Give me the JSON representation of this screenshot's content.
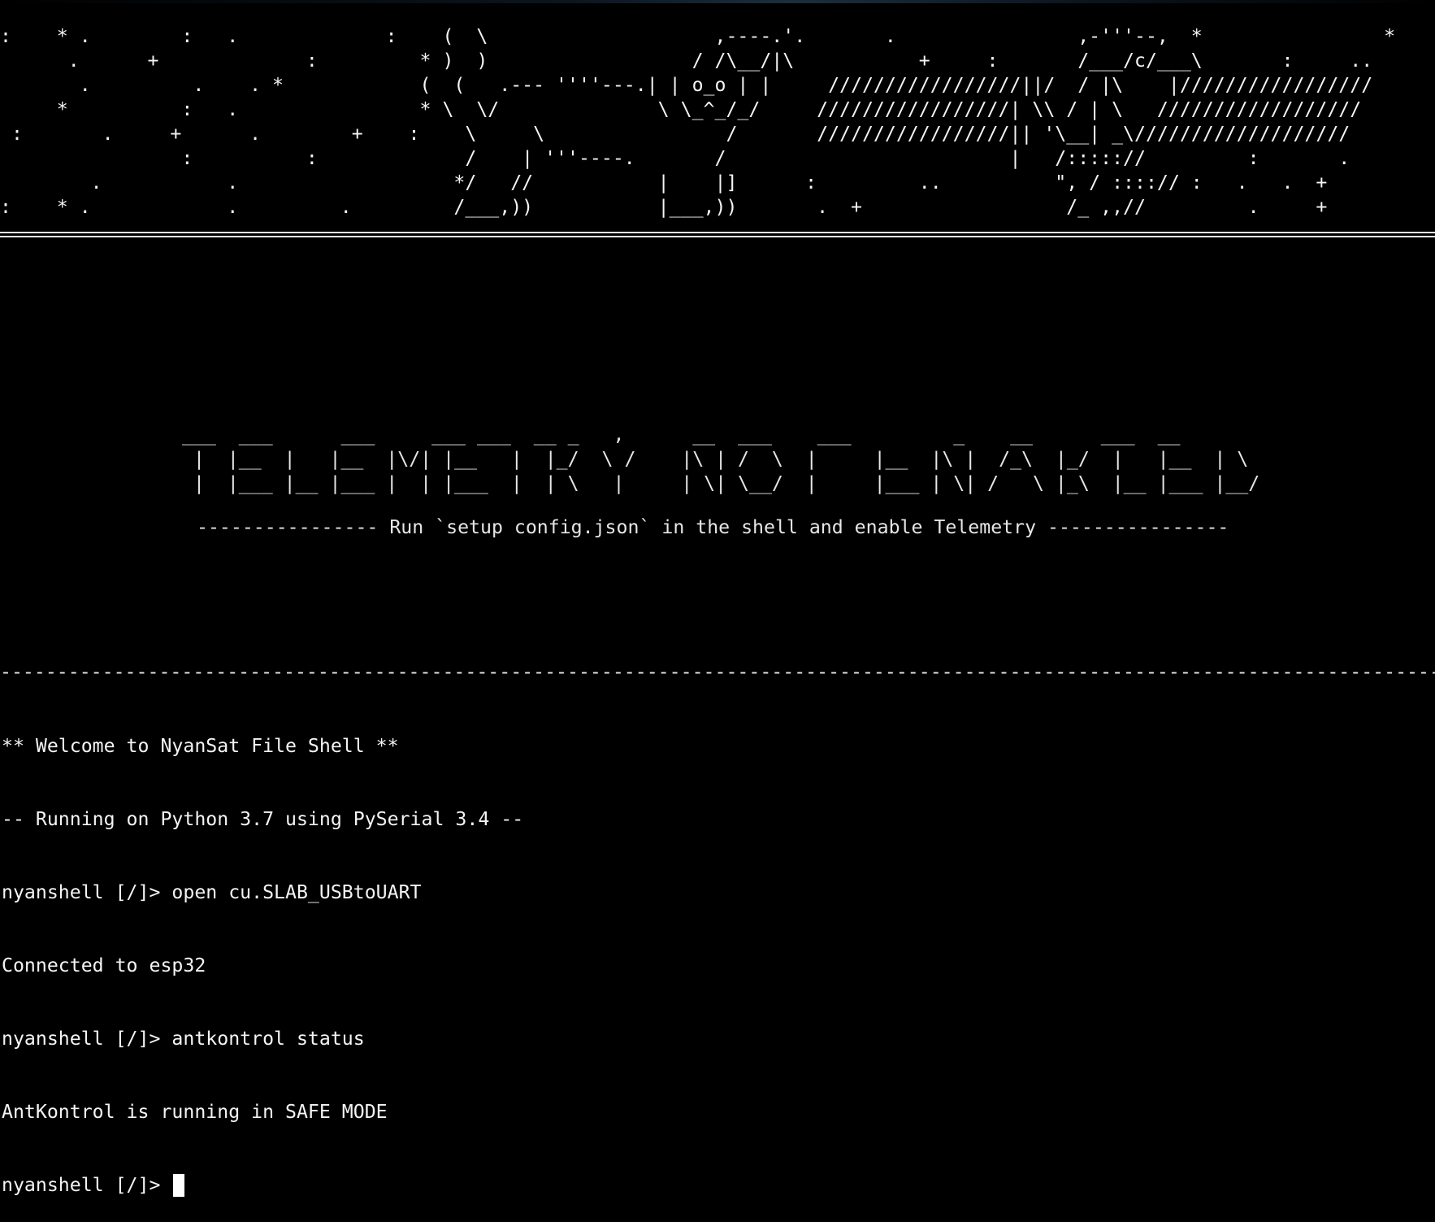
{
  "banner": {
    "art": ":    * .        :   .             :    (  \\                    ,----.'.       .                ,-'''--,  *                *\n      .      +             :         * )  )                  / /\\__/|\\           +     :       /___/c/___\\       :     ..\n       .         .    . *            (  (   .--- ''''---.| | o_o | |     /////////////////||/  / |\\    |/////////////////\n     *          :   .                * \\  \\/              \\ \\_^_/_/     /////////////////| \\\\ / | \\   //////////////////\n :       .     +      .        +    :    \\     \\                /       /////////////////|| '\\__| _\\///////////////////\n                :          :             /    | '''----.       /                         |   /::::://         :       .\n        .           .                   */   //           |    |]      :         ..          \", / ::::// :   .   .  +\n:    * .            .         .         /___,))           |___,))       .  +                  /_ ,,//         .     +"
  },
  "telemetry": {
    "title_art": "___  ___      ___     ___ ___  __ _   ,      __  ___    ___         _    __      ___  __\n |  |__  |   |__  |\\/| |__   |  |_/  \\ /    |\\ | /  \\  |     |__  |\\ |  /_\\  |_/  |   |__  | \\\n |  |___ |__ |___ |  | |___  |  | \\   |     | \\| \\__/  |     |___ | \\| /   \\ |_\\  |__ |___ |__/",
    "hint": "---------------- Run `setup config.json` in the shell and enable Telemetry ----------------"
  },
  "shell": {
    "separator": "---------------------------------------------------------------------------------------------------------------------------------",
    "lines": [
      "** Welcome to NyanSat File Shell **",
      "-- Running on Python 3.7 using PySerial 3.4 --",
      "nyanshell [/]> open cu.SLAB_USBtoUART",
      "Connected to esp32",
      "nyanshell [/]> antkontrol status",
      "AntKontrol is running in SAFE MODE"
    ],
    "prompt": "nyanshell [/]> ",
    "input_value": ""
  },
  "colors": {
    "background": "#000000",
    "foreground": "#f4f4f4",
    "cursor": "#ffffff"
  }
}
